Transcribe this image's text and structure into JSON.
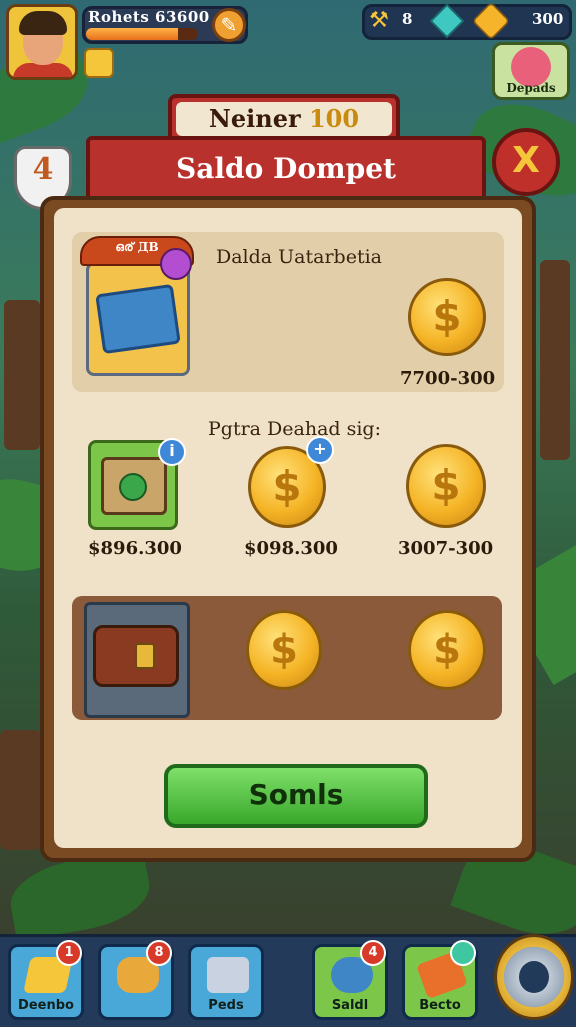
{
  "hud": {
    "player_name": "Rohets 63600",
    "xp_fraction": 0.82,
    "hammer_count": "8",
    "coin_count": "300",
    "depads_label": "Depads"
  },
  "header": {
    "ribbon_text": "Neiner",
    "ribbon_number": "100",
    "level": "4",
    "title": "Saldo Dompet",
    "close_symbol": "X"
  },
  "panel": {
    "section1": {
      "banner": "ഒര് ДВ",
      "subtitle": "Dalda Uatarbetia",
      "price": "7700-300"
    },
    "section2": {
      "subtitle": "Pgtra Deahad sig:",
      "info_symbol": "i",
      "plus_symbol": "+",
      "prices": [
        "$896.300",
        "$098.300",
        "3007-300"
      ]
    },
    "coin_symbol": "$",
    "action_button": "Somls"
  },
  "bottom_nav": {
    "items": [
      {
        "label": "Deenbo",
        "badge": "1",
        "icon": "gold-bar-icon"
      },
      {
        "label": "",
        "badge": "8",
        "icon": "coin-stack-icon"
      },
      {
        "label": "Peds",
        "badge": "",
        "icon": "stack-icon"
      },
      {
        "label": "Saldl",
        "badge": "4",
        "icon": "gem-blob-icon"
      },
      {
        "label": "Becto",
        "badge": "",
        "icon": "hammer-icon"
      }
    ],
    "settings_icon": "settings-gear-icon"
  },
  "colors": {
    "ribbon_red": "#b8312c",
    "paper": "#efe2c8",
    "button_green": "#38a82a",
    "coin_gold": "#f5b426"
  }
}
